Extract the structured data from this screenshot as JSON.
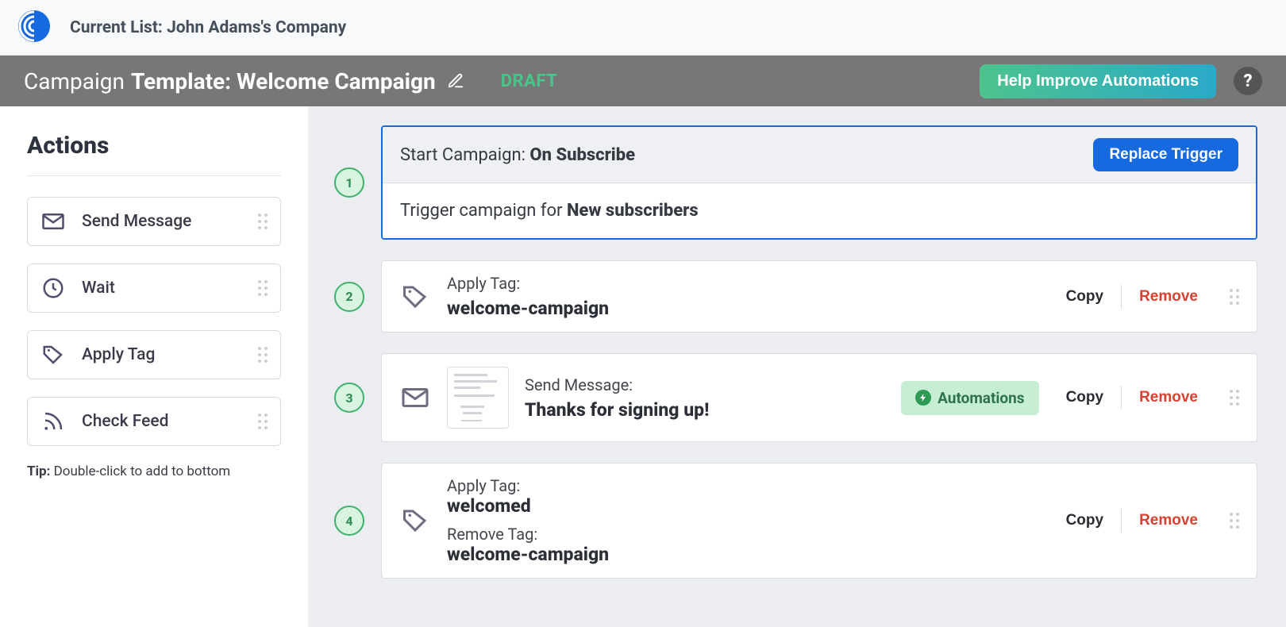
{
  "topbar": {
    "list_label": "Current List: John Adams's Company"
  },
  "header": {
    "prefix": "Campaign",
    "title": "Template: Welcome Campaign",
    "status": "DRAFT",
    "help_improve": "Help Improve Automations",
    "help_glyph": "?"
  },
  "sidebar": {
    "title": "Actions",
    "actions": [
      {
        "icon": "envelope-icon",
        "label": "Send Message"
      },
      {
        "icon": "clock-icon",
        "label": "Wait"
      },
      {
        "icon": "tag-icon",
        "label": "Apply Tag"
      },
      {
        "icon": "feed-icon",
        "label": "Check Feed"
      }
    ],
    "tip_prefix": "Tip:",
    "tip_text": "Double-click to add to bottom"
  },
  "steps": {
    "trigger": {
      "number": "1",
      "head_prefix": "Start Campaign: ",
      "head_bold": "On Subscribe",
      "replace_btn": "Replace Trigger",
      "body_prefix": "Trigger campaign for ",
      "body_bold": "New subscribers"
    },
    "s2": {
      "number": "2",
      "label": "Apply Tag:",
      "value": "welcome-campaign",
      "copy": "Copy",
      "remove": "Remove"
    },
    "s3": {
      "number": "3",
      "label": "Send Message:",
      "value": "Thanks for signing up!",
      "automations": "Automations",
      "copy": "Copy",
      "remove": "Remove"
    },
    "s4": {
      "number": "4",
      "label1": "Apply Tag:",
      "value1": "welcomed",
      "label2": "Remove Tag:",
      "value2": "welcome-campaign",
      "copy": "Copy",
      "remove": "Remove"
    }
  }
}
